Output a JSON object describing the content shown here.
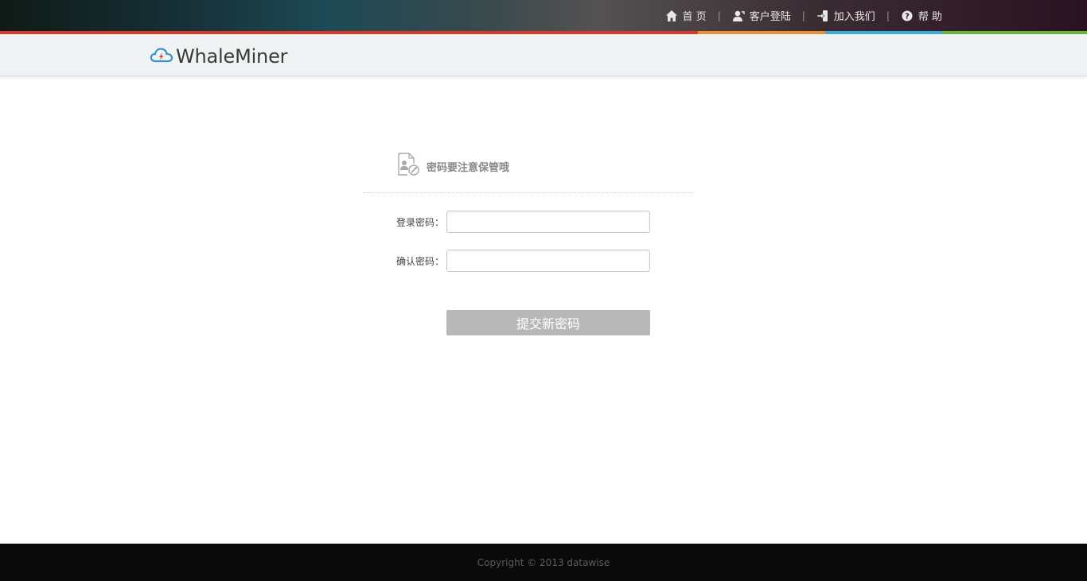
{
  "topnav": {
    "items": [
      {
        "label": "首 页",
        "icon": "home-icon"
      },
      {
        "label": "客户登陆",
        "icon": "user-icon"
      },
      {
        "label": "加入我们",
        "icon": "sign-in-icon"
      },
      {
        "label": "帮 助",
        "icon": "help-icon"
      }
    ],
    "separator": "|"
  },
  "brand": {
    "name": "WhaleMiner",
    "logo_icon": "cloud-bolt-icon",
    "stripe_colors": [
      "#d93a2b",
      "#e8903a",
      "#3fa9d9",
      "#6cb33f"
    ]
  },
  "form": {
    "title": "密码要注意保管哦",
    "title_icon": "document-key-icon",
    "fields": [
      {
        "label": "登录密码：",
        "value": ""
      },
      {
        "label": "确认密码：",
        "value": ""
      }
    ],
    "submit_label": "提交新密码"
  },
  "footer": {
    "copyright": "Copyright © 2013 datawise"
  }
}
